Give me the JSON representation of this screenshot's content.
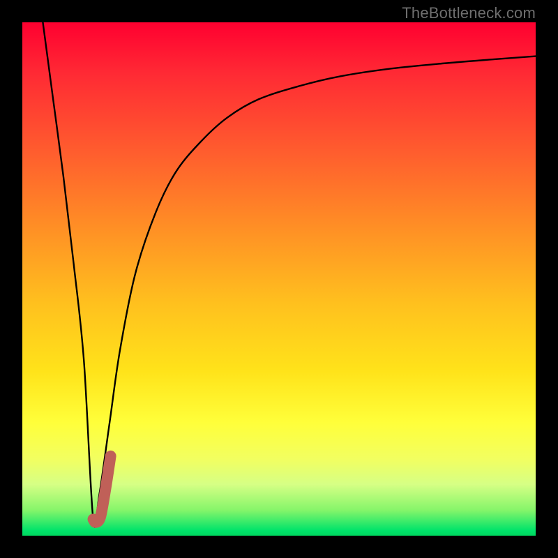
{
  "watermark": "TheBottleneck.com",
  "chart_data": {
    "type": "line",
    "title": "",
    "xlabel": "",
    "ylabel": "",
    "xlim": [
      0,
      100
    ],
    "ylim": [
      0,
      100
    ],
    "grid": false,
    "legend": false,
    "series": [
      {
        "name": "bottleneck-curve",
        "color": "#000000",
        "x": [
          4,
          6,
          8,
          10,
          12,
          13.8,
          15,
          17,
          19,
          22,
          26,
          30,
          35,
          40,
          46,
          54,
          62,
          72,
          82,
          92,
          100
        ],
        "y": [
          100,
          85,
          70,
          53,
          34,
          3.2,
          8,
          22,
          36,
          51,
          63,
          71,
          77,
          81.5,
          85,
          87.6,
          89.5,
          91,
          92,
          92.8,
          93.4
        ]
      },
      {
        "name": "highlight-segment",
        "color": "#c06058",
        "x": [
          13.8,
          14.3,
          15.2,
          16.2,
          17.2
        ],
        "y": [
          3.2,
          2.6,
          3.6,
          9.0,
          15.5
        ]
      }
    ]
  },
  "colors": {
    "frame": "#000000",
    "curve": "#000000",
    "highlight": "#c06058",
    "watermark": "#6f6f6f"
  }
}
